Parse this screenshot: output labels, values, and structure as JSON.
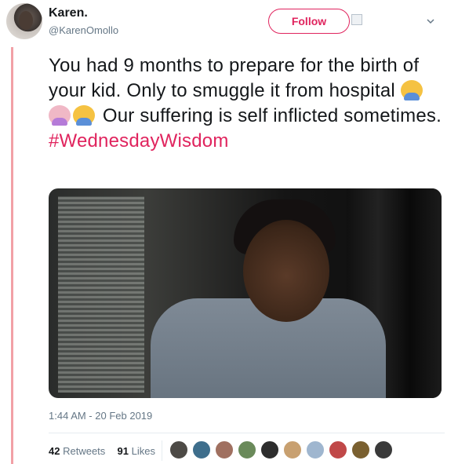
{
  "tweet": {
    "author_name": "Karen.",
    "author_handle": "@KarenOmollo",
    "follow_label": "Follow",
    "text_part1": "You had 9 months to prepare for the birth of your kid. Only to smuggle it from hospital",
    "emojis": [
      "man-gesturing-emoji",
      "woman-gesturing-emoji",
      "man-gesturing-emoji"
    ],
    "text_part2": " Our suffering is self inflicted sometimes.",
    "hashtag": "#WednesdayWisdom",
    "timestamp": "1:44 AM - 20 Feb 2019",
    "retweets_count": "42",
    "retweets_label": "Retweets",
    "likes_count": "91",
    "likes_label": "Likes"
  },
  "liker_avatars": [
    "#4d4a46",
    "#3e6e8c",
    "#a07060",
    "#6a8a5a",
    "#2d2d2d",
    "#c8a070",
    "#9fb6cf",
    "#c04848",
    "#7a6030",
    "#3a3a3a"
  ],
  "colors": {
    "accent": "#e0245e",
    "secondary_text": "#657786",
    "thread_line": "#f2a0a6"
  }
}
